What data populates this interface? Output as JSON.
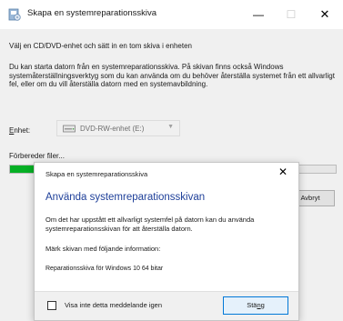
{
  "window": {
    "title": "Skapa en systemreparationsskiva",
    "minimize_glyph": "—",
    "maximize_glyph": "☐",
    "close_glyph": "✕"
  },
  "main": {
    "instruction": "Välj en CD/DVD-enhet och sätt in en tom skiva i enheten",
    "description": "Du kan starta datorn från en systemreparationsskiva. På skivan finns också Windows systemåterställningsverktyg som du kan använda om du behöver återställa systemet från ett allvarligt fel, eller om du vill återställa datorn med en systemavbildning.",
    "unit_label_accel": "E",
    "unit_label_rest": "nhet:",
    "drive_value": "DVD-RW-enhet (E:)",
    "preparing_text": "Förbereder filer...",
    "progress": 0.12,
    "cancel_label": "Avbryt"
  },
  "dialog": {
    "title": "Skapa en systemreparationsskiva",
    "close_glyph": "✕",
    "heading": "Använda systemreparationsskivan",
    "body": "Om det har uppstått ett allvarligt systemfel på datorn kan du använda systemreparationsskivan för att återställa datorn.",
    "mark_text": "Märk skivan med följande information:",
    "disc_info": "Reparationsskiva för Windows 10 64 bitar",
    "checkbox_label": "Visa inte detta meddelande igen",
    "checkbox_checked": false,
    "close_button_pre": "Stä",
    "close_button_accel": "n",
    "close_button_post": "g"
  },
  "colors": {
    "progress": "#06b025",
    "heading": "#1e3f99",
    "default_button_border": "#0078d7"
  }
}
